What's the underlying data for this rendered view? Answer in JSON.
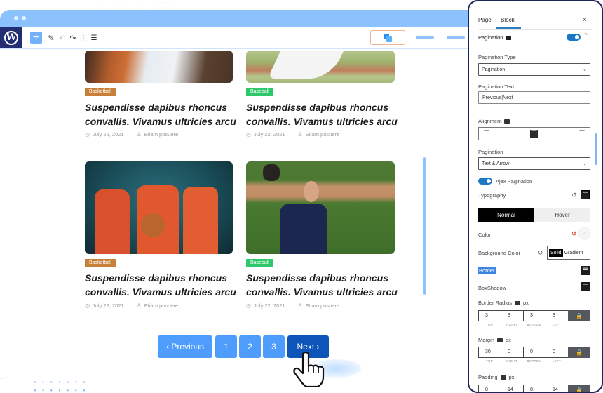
{
  "browser": {
    "toolbar": {
      "add_label": "+",
      "tools": [
        "pencil-icon",
        "undo-icon",
        "redo-icon",
        "info-icon",
        "list-view-icon"
      ]
    }
  },
  "posts": [
    {
      "category": "Basketball",
      "title_line1": "Suspendisse dapibus rhoncus",
      "title_line2": "convallis. Vivamus ultricies arcu",
      "date": "July 22, 2021",
      "author": "Etiam posuere"
    },
    {
      "category": "Baseball",
      "title_line1": "Suspendisse dapibus rhoncus",
      "title_line2": "convallis. Vivamus ultricies arcu",
      "date": "July 22, 2021",
      "author": "Etiam posuere"
    },
    {
      "category": "Basketball",
      "title_line1": "Suspendisse dapibus rhoncus",
      "title_line2": "convallis. Vivamus ultricies arcu",
      "date": "July 22, 2021",
      "author": "Etiam posuere"
    },
    {
      "category": "Baseball",
      "title_line1": "Suspendisse dapibus rhoncus",
      "title_line2": "convallis. Vivamus ultricies arcu",
      "date": "July 22, 2021",
      "author": "Etiam posuere"
    }
  ],
  "pagination": {
    "previous": "‹  Previous",
    "pages": [
      "1",
      "2",
      "3"
    ],
    "next": "Next  ›"
  },
  "panel": {
    "tabs": {
      "page": "Page",
      "block": "Block",
      "active": "Block"
    },
    "close": "×",
    "section_title": "Pagination",
    "section_enabled": true,
    "pagination_type_label": "Pagination Type",
    "pagination_type_value": "Pagination",
    "pagination_text_label": "Pagination Text",
    "pagination_text_value": "Previous|Next",
    "alignment_label": "Alignment",
    "alignment_selected": "center",
    "pagination_style_label": "Pagination",
    "pagination_style_value": "Text & Arrow",
    "ajax_label": "Ajax Pagination",
    "ajax_enabled": true,
    "typography_label": "Typography",
    "state_tabs": {
      "normal": "Normal",
      "hover": "Hover",
      "active": "Normal"
    },
    "color_label": "Color",
    "bg_color_label": "Background Color",
    "bg_solid": "Solid",
    "bg_gradient": "Gradient",
    "border_label": "Border",
    "boxshadow_label": "BoxShadow",
    "border_radius": {
      "label": "Border Radius",
      "unit": "px",
      "values": [
        "3",
        "3",
        "3",
        "3"
      ]
    },
    "margin": {
      "label": "Margin",
      "unit": "px",
      "values": [
        "30",
        "0",
        "0",
        "0"
      ]
    },
    "padding": {
      "label": "Padding",
      "unit": "px",
      "values": [
        "8",
        "14",
        "8",
        "14"
      ]
    },
    "dim_labels": [
      "TOP",
      "RIGHT",
      "BOTTOM",
      "LEFT"
    ],
    "lock_icon": "🔒"
  },
  "colors": {
    "accent": "#4e9cfc",
    "next_active": "#0d55b9",
    "basketball_badge": "#c88039",
    "baseball_badge": "#2dc86a",
    "toggle": "#1b78c7",
    "panel_border": "#1c2559"
  }
}
